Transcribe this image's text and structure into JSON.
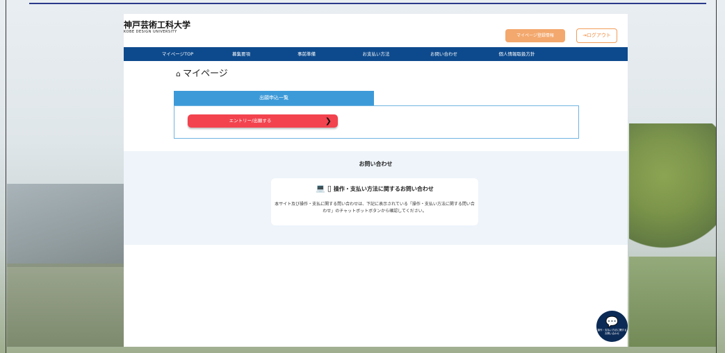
{
  "brand": {
    "name_jp": "神戸芸術工科大学",
    "name_en": "KOBE DESIGN UNIVERSITY"
  },
  "header": {
    "mypage_info_label": "マイページ登録情報",
    "logout_label": "ログアウト"
  },
  "nav": {
    "items": [
      "マイページTOP",
      "募集要項",
      "事前準備",
      "お支払い方法",
      "お問い合わせ",
      "個人情報取扱方針"
    ]
  },
  "page": {
    "title": "マイページ"
  },
  "application": {
    "tab_label": "出願申込一覧",
    "entry_button_label": "エントリー/出願する"
  },
  "contact": {
    "heading": "お問い合わせ",
    "card_title": "操作・支払い方法に関するお問い合わせ",
    "card_text": "本サイト及び操作・支払に関する問い合わせは、下記に表示されている「操作・支払い方法に関する問い合わせ」のチャットボットボタンから確認してください。"
  },
  "chatbot": {
    "label": "操作・支払い方法に関する お問い合わせ"
  },
  "colors": {
    "nav": "#0d4a8d",
    "tab": "#3d9ad8",
    "entry_button": "#f2434e",
    "accent_orange": "#f3a86d",
    "chat_button": "#0b2a55"
  },
  "icons": {
    "home": "home-icon",
    "logout": "logout-icon",
    "laptop": "laptop-icon",
    "phone": "smartphone-icon",
    "chat": "chat-bubbles-icon",
    "arrow": "arrow-right-icon"
  }
}
